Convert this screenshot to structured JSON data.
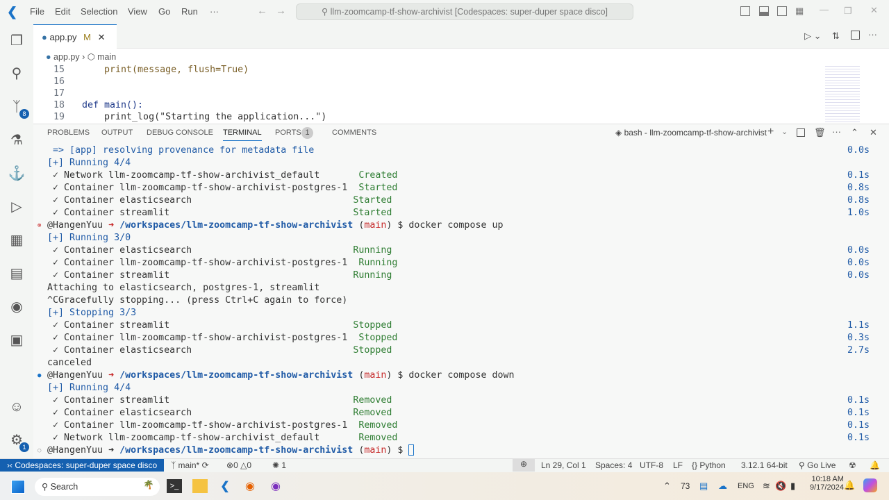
{
  "titlebar": {
    "menus": [
      "File",
      "Edit",
      "Selection",
      "View",
      "Go",
      "Run",
      "···"
    ],
    "command_center": "llm-zoomcamp-tf-show-archivist [Codespaces: super-duper space disco]"
  },
  "activity": {
    "source_control_badge": "8",
    "accounts_badge": "1"
  },
  "tab": {
    "filename": "app.py",
    "modified": "M"
  },
  "breadcrumb": {
    "file": "app.py",
    "symbol": "main"
  },
  "editor": {
    "lines": [
      {
        "num": "15",
        "code": "    print(message, flush=True)"
      },
      {
        "num": "16",
        "code": ""
      },
      {
        "num": "17",
        "code": ""
      },
      {
        "num": "18",
        "code": "def main():"
      },
      {
        "num": "19",
        "code": "    print_log(\"Starting the application...\")"
      }
    ]
  },
  "panel": {
    "tabs": [
      "PROBLEMS",
      "OUTPUT",
      "DEBUG CONSOLE",
      "TERMINAL",
      "PORTS",
      "COMMENTS"
    ],
    "ports_badge": "1",
    "active": "TERMINAL",
    "terminal_name": "bash - llm-zoomcamp-tf-show-archivist"
  },
  "terminal": {
    "lines": [
      {
        "segs": [
          [
            " => [app] resolving provenance for metadata file",
            "blue"
          ]
        ],
        "time": "0.0s"
      },
      {
        "segs": [
          [
            "[+] Running 4/4",
            "blue"
          ]
        ]
      },
      {
        "segs": [
          [
            " ✓ Network llm-zoomcamp-tf-show-archivist_default       ",
            "dark"
          ],
          [
            "Created",
            "green"
          ]
        ],
        "time": "0.1s"
      },
      {
        "segs": [
          [
            " ✓ Container llm-zoomcamp-tf-show-archivist-postgres-1  ",
            "dark"
          ],
          [
            "Started",
            "green"
          ]
        ],
        "time": "0.8s"
      },
      {
        "segs": [
          [
            " ✓ Container elasticsearch                             ",
            "dark"
          ],
          [
            "Started",
            "green"
          ]
        ],
        "time": "0.8s"
      },
      {
        "segs": [
          [
            " ✓ Container streamlit                                 ",
            "dark"
          ],
          [
            "Started",
            "green"
          ]
        ],
        "time": "1.0s"
      },
      {
        "dot": "⊗",
        "dotcolor": "#c62828",
        "segs": [
          [
            "@HangenYuu ",
            "dark"
          ],
          [
            "➜ ",
            "arrowred"
          ],
          [
            "/workspaces/llm-zoomcamp-tf-show-archivist",
            "bold"
          ],
          [
            " (",
            "dark"
          ],
          [
            "main",
            "red"
          ],
          [
            ") $ docker compose up",
            "dark"
          ]
        ]
      },
      {
        "segs": [
          [
            "[+] Running 3/0",
            "blue"
          ]
        ]
      },
      {
        "segs": [
          [
            " ✓ Container elasticsearch                             ",
            "dark"
          ],
          [
            "Running",
            "green"
          ]
        ],
        "time": "0.0s"
      },
      {
        "segs": [
          [
            " ✓ Container llm-zoomcamp-tf-show-archivist-postgres-1  ",
            "dark"
          ],
          [
            "Running",
            "green"
          ]
        ],
        "time": "0.0s"
      },
      {
        "segs": [
          [
            " ✓ Container streamlit                                 ",
            "dark"
          ],
          [
            "Running",
            "green"
          ]
        ],
        "time": "0.0s"
      },
      {
        "segs": [
          [
            "Attaching to elasticsearch, postgres-1, streamlit",
            "dark"
          ]
        ]
      },
      {
        "segs": [
          [
            "^CGracefully stopping... (press Ctrl+C again to force)",
            "dark"
          ]
        ]
      },
      {
        "segs": [
          [
            "[+] Stopping 3/3",
            "blue"
          ]
        ]
      },
      {
        "segs": [
          [
            " ✓ Container streamlit                                 ",
            "dark"
          ],
          [
            "Stopped",
            "green"
          ]
        ],
        "time": "1.1s"
      },
      {
        "segs": [
          [
            " ✓ Container llm-zoomcamp-tf-show-archivist-postgres-1  ",
            "dark"
          ],
          [
            "Stopped",
            "green"
          ]
        ],
        "time": "0.3s"
      },
      {
        "segs": [
          [
            " ✓ Container elasticsearch                             ",
            "dark"
          ],
          [
            "Stopped",
            "green"
          ]
        ],
        "time": "2.7s"
      },
      {
        "segs": [
          [
            "canceled",
            "dark"
          ]
        ]
      },
      {
        "dot": "●",
        "dotcolor": "#1a73c8",
        "segs": [
          [
            "@HangenYuu ",
            "dark"
          ],
          [
            "➜ ",
            "arrowred"
          ],
          [
            "/workspaces/llm-zoomcamp-tf-show-archivist",
            "bold"
          ],
          [
            " (",
            "dark"
          ],
          [
            "main",
            "red"
          ],
          [
            ") $ docker compose down",
            "dark"
          ]
        ]
      },
      {
        "segs": [
          [
            "[+] Running 4/4",
            "blue"
          ]
        ]
      },
      {
        "segs": [
          [
            " ✓ Container streamlit                                 ",
            "dark"
          ],
          [
            "Removed",
            "green"
          ]
        ],
        "time": "0.1s"
      },
      {
        "segs": [
          [
            " ✓ Container elasticsearch                             ",
            "dark"
          ],
          [
            "Removed",
            "green"
          ]
        ],
        "time": "0.1s"
      },
      {
        "segs": [
          [
            " ✓ Container llm-zoomcamp-tf-show-archivist-postgres-1  ",
            "dark"
          ],
          [
            "Removed",
            "green"
          ]
        ],
        "time": "0.1s"
      },
      {
        "segs": [
          [
            " ✓ Network llm-zoomcamp-tf-show-archivist_default       ",
            "dark"
          ],
          [
            "Removed",
            "green"
          ]
        ],
        "time": "0.1s"
      },
      {
        "dot": "○",
        "dotcolor": "#999",
        "segs": [
          [
            "@HangenYuu ",
            "dark"
          ],
          [
            "➜ ",
            "arrow"
          ],
          [
            "/workspaces/llm-zoomcamp-tf-show-archivist",
            "bold"
          ],
          [
            " (",
            "dark"
          ],
          [
            "main",
            "red"
          ],
          [
            ") $ ",
            "dark"
          ]
        ],
        "cursor": true
      }
    ]
  },
  "status": {
    "remote": "Codespaces: super-duper space disco",
    "branch": "main*",
    "errors": "0",
    "warnings": "0",
    "ports": "1",
    "position": "Ln 29, Col 1",
    "spaces": "Spaces: 4",
    "encoding": "UTF-8",
    "eol": "LF",
    "language": "Python",
    "interpreter": "3.12.1 64-bit",
    "golive": "Go Live"
  },
  "taskbar": {
    "search": "Search",
    "temp": "73",
    "lang": "ENG",
    "time": "10:18 AM",
    "date": "9/17/2024"
  },
  "colors": {
    "accent": "#1560b0",
    "green": "#2e7d32",
    "red": "#c62828"
  }
}
